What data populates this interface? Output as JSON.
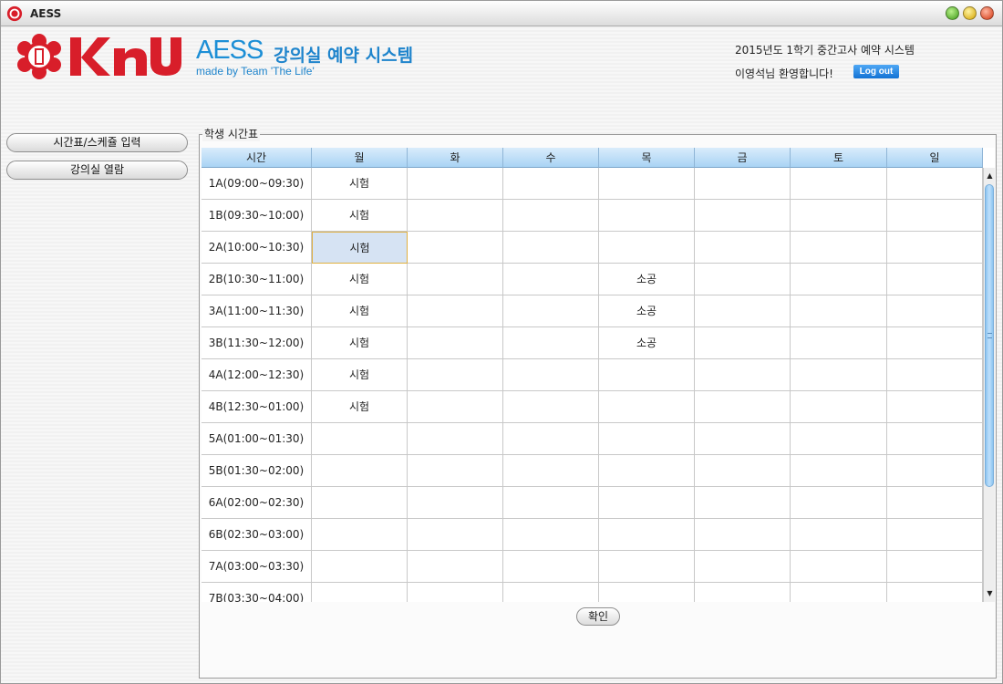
{
  "window": {
    "title": "AESS"
  },
  "header": {
    "aess_logo": "AESS",
    "korean_title": "강의실 예약 시스템",
    "made_by": "made by Team  'The Life'",
    "semester": "2015년도 1학기 중간고사 예약 시스템",
    "welcome": "이영석님 환영합니다!",
    "logout_label": "Log out",
    "brand_color": "#d81e2a",
    "accent_color": "#1e84cc"
  },
  "sidebar": {
    "items": [
      {
        "label": "시간표/스케쥴 입력"
      },
      {
        "label": "강의실 열람"
      }
    ]
  },
  "main": {
    "group_title": "학생 시간표",
    "columns": [
      "시간",
      "월",
      "화",
      "수",
      "목",
      "금",
      "토",
      "일"
    ],
    "rows": [
      [
        "1A(09:00~09:30)",
        "시험",
        "",
        "",
        "",
        "",
        "",
        ""
      ],
      [
        "1B(09:30~10:00)",
        "시험",
        "",
        "",
        "",
        "",
        "",
        ""
      ],
      [
        "2A(10:00~10:30)",
        "시험",
        "",
        "",
        "",
        "",
        "",
        ""
      ],
      [
        "2B(10:30~11:00)",
        "시험",
        "",
        "",
        "소공",
        "",
        "",
        ""
      ],
      [
        "3A(11:00~11:30)",
        "시험",
        "",
        "",
        "소공",
        "",
        "",
        ""
      ],
      [
        "3B(11:30~12:00)",
        "시험",
        "",
        "",
        "소공",
        "",
        "",
        ""
      ],
      [
        "4A(12:00~12:30)",
        "시험",
        "",
        "",
        "",
        "",
        "",
        ""
      ],
      [
        "4B(12:30~01:00)",
        "시험",
        "",
        "",
        "",
        "",
        "",
        ""
      ],
      [
        "5A(01:00~01:30)",
        "",
        "",
        "",
        "",
        "",
        "",
        ""
      ],
      [
        "5B(01:30~02:00)",
        "",
        "",
        "",
        "",
        "",
        "",
        ""
      ],
      [
        "6A(02:00~02:30)",
        "",
        "",
        "",
        "",
        "",
        "",
        ""
      ],
      [
        "6B(02:30~03:00)",
        "",
        "",
        "",
        "",
        "",
        "",
        ""
      ],
      [
        "7A(03:00~03:30)",
        "",
        "",
        "",
        "",
        "",
        "",
        ""
      ],
      [
        "7B(03:30~04:00)",
        "",
        "",
        "",
        "",
        "",
        "",
        ""
      ]
    ],
    "selected_cell": "2A 월",
    "confirm_label": "확인"
  }
}
